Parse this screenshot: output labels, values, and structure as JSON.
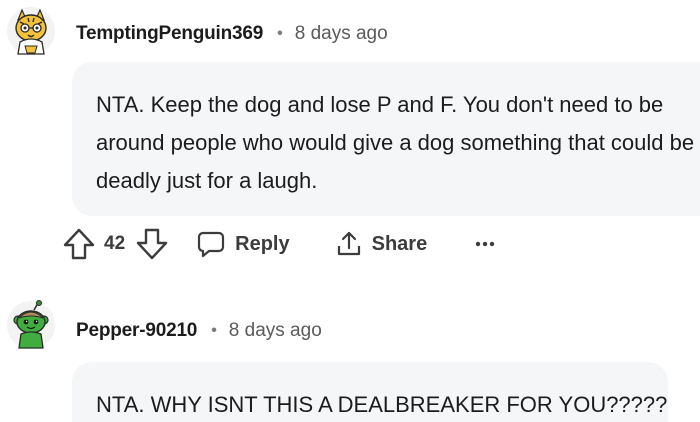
{
  "comments": [
    {
      "username": "TemptingPenguin369",
      "separator": "•",
      "timestamp": "8 days ago",
      "avatar_icon": "yellow-cat-avatar-icon",
      "body": "NTA. Keep the dog and lose P and F. You don't need to be around people who would give a dog something that could be deadly just for a laugh.",
      "votes": "42",
      "reply_label": "Reply",
      "share_label": "Share",
      "more_label": "•••"
    },
    {
      "username": "Pepper-90210",
      "separator": "•",
      "timestamp": "8 days ago",
      "avatar_icon": "green-snoo-avatar-icon",
      "body": "NTA. WHY ISNT THIS A DEALBREAKER FOR YOU?????"
    }
  ],
  "colors": {
    "bubble": "#f5f6f8",
    "text": "#1c1c1c",
    "muted": "#5a5a5a",
    "action": "#3c3c3c"
  }
}
